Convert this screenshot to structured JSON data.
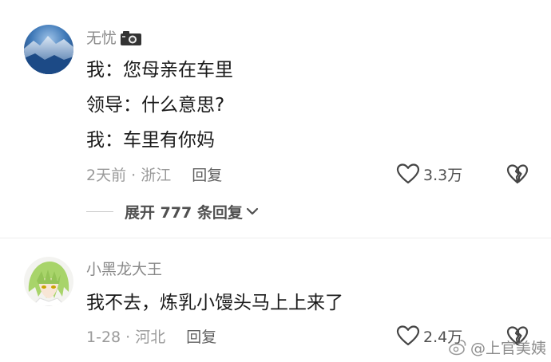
{
  "comments": [
    {
      "username": "无忧",
      "username_icon": "camera-icon",
      "lines": [
        "我：您母亲在车里",
        "领导：什么意思?",
        "我：车里有你妈"
      ],
      "meta": "2天前 · 浙江",
      "reply_label": "回复",
      "likes": "3.3万",
      "expand_label": "展开 777 条回复"
    },
    {
      "username": "小黑龙大王",
      "lines": [
        "我不去，炼乳小馒头马上上来了"
      ],
      "meta": "1-28 · 河北",
      "reply_label": "回复",
      "likes": "2.4万"
    }
  ],
  "watermark": "@上官美姨",
  "colors": {
    "username": "#8a8a8a",
    "text": "#1a1a1a",
    "meta": "#9a9a9a",
    "background": "#ffffff"
  }
}
